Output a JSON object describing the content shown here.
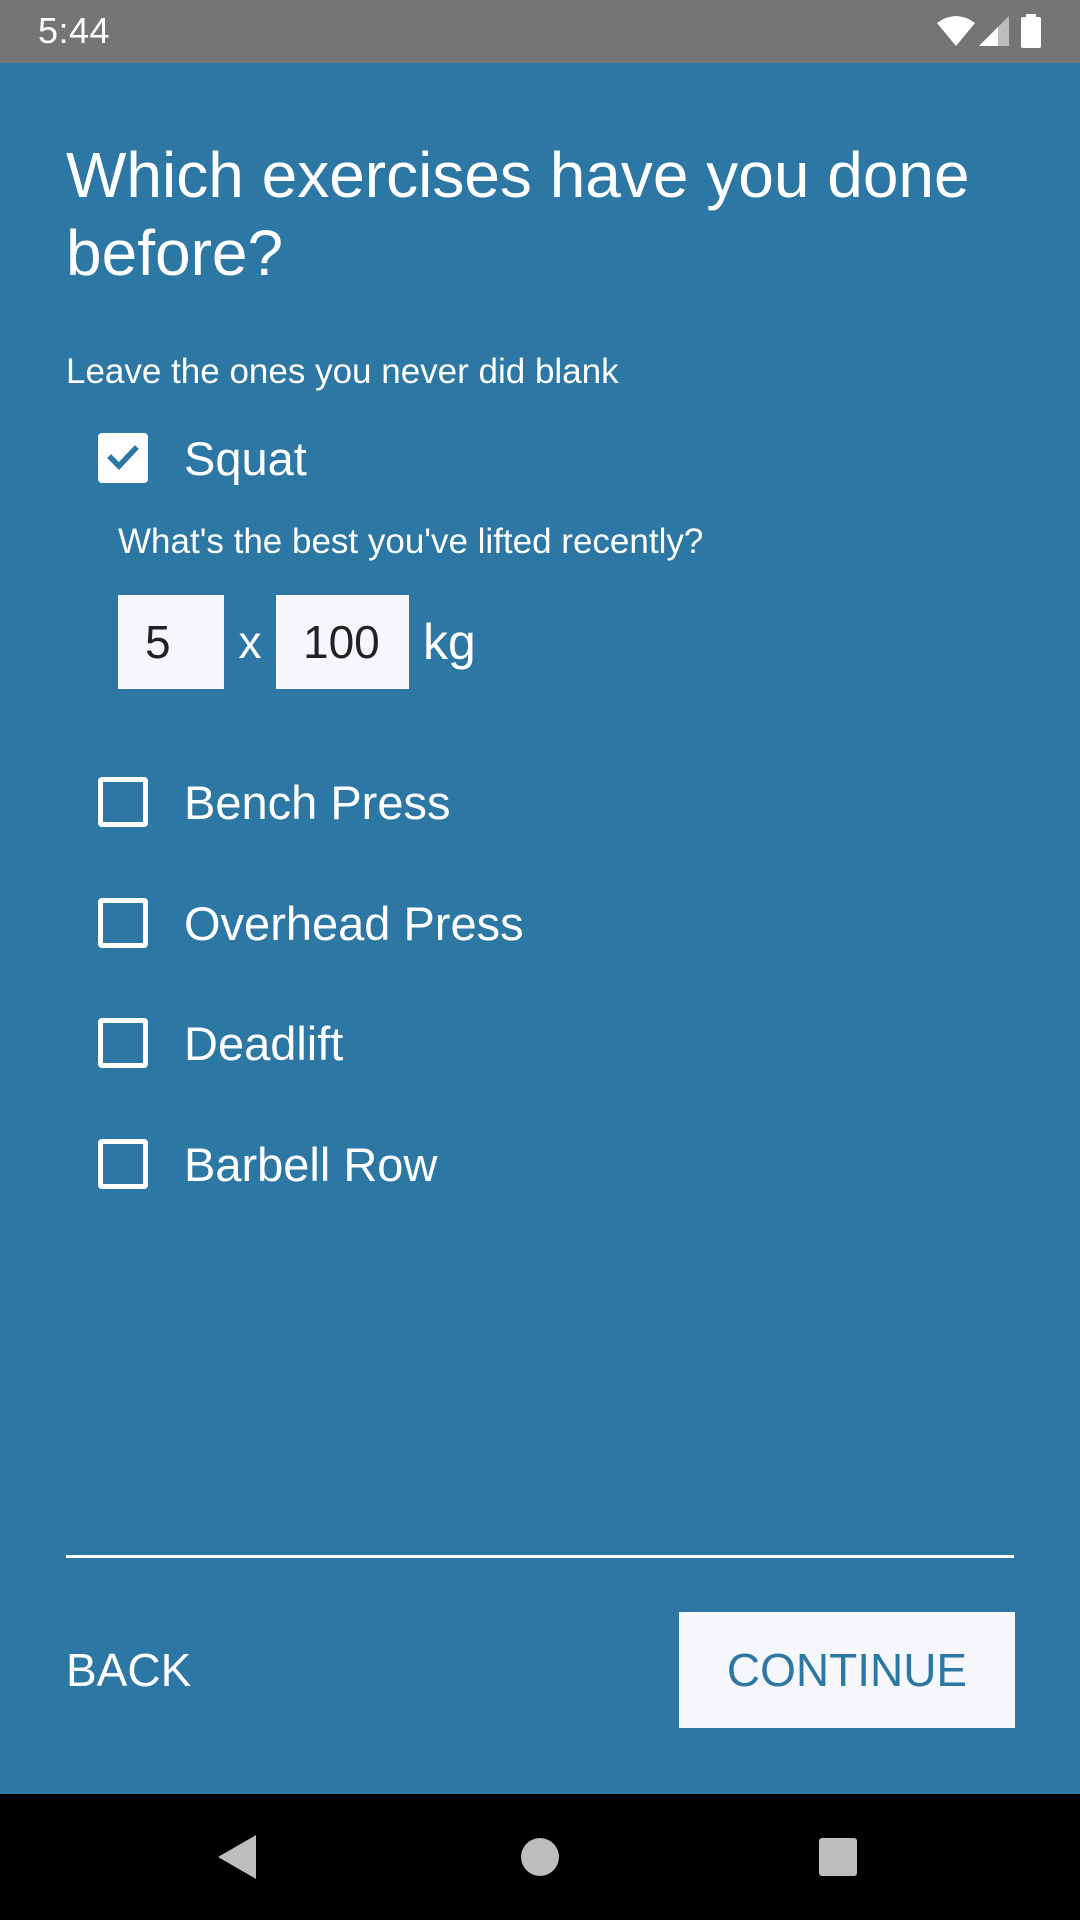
{
  "status_bar": {
    "time": "5:44",
    "icons": [
      "wifi-icon",
      "signal-icon",
      "battery-icon"
    ]
  },
  "page": {
    "title": "Which exercises have you done before?",
    "subtitle": "Leave the ones you never did blank"
  },
  "exercises": [
    {
      "label": "Squat",
      "checked": true
    },
    {
      "label": "Bench Press",
      "checked": false
    },
    {
      "label": "Overhead Press",
      "checked": false
    },
    {
      "label": "Deadlift",
      "checked": false
    },
    {
      "label": "Barbell Row",
      "checked": false
    }
  ],
  "squat_detail": {
    "question": "What's the best you've lifted recently?",
    "reps": "5",
    "times_symbol": "x",
    "weight": "100",
    "unit": "kg"
  },
  "footer": {
    "back_label": "BACK",
    "continue_label": "CONTINUE"
  },
  "nav_bar": {
    "icons": [
      "back-triangle-icon",
      "home-circle-icon",
      "recents-square-icon"
    ]
  },
  "colors": {
    "background": "#2c77a4",
    "status_bar": "#757575",
    "field_background": "#f5f7fb",
    "accent": "#2c77a4"
  }
}
